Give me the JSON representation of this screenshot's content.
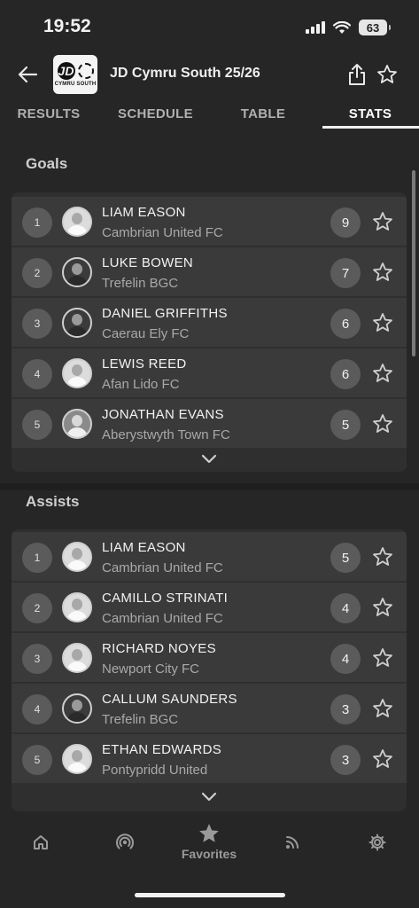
{
  "status_bar": {
    "time": "19:52",
    "battery": "63"
  },
  "header": {
    "title": "JD Cymru South 25/26",
    "logo_text": "CYMRU SOUTH",
    "logo_mark": "JD"
  },
  "tabs": [
    {
      "label": "RESULTS",
      "active": false
    },
    {
      "label": "SCHEDULE",
      "active": false
    },
    {
      "label": "TABLE",
      "active": false
    },
    {
      "label": "STATS",
      "active": true
    }
  ],
  "goals": {
    "title": "Goals",
    "rows": [
      {
        "rank": "1",
        "name": "LIAM EASON",
        "team": "Cambrian United FC",
        "value": "9"
      },
      {
        "rank": "2",
        "name": "LUKE BOWEN",
        "team": "Trefelin BGC",
        "value": "7"
      },
      {
        "rank": "3",
        "name": "DANIEL GRIFFITHS",
        "team": "Caerau Ely FC",
        "value": "6"
      },
      {
        "rank": "4",
        "name": "LEWIS REED",
        "team": "Afan Lido FC",
        "value": "6"
      },
      {
        "rank": "5",
        "name": "JONATHAN EVANS",
        "team": "Aberystwyth Town FC",
        "value": "5"
      }
    ]
  },
  "assists": {
    "title": "Assists",
    "rows": [
      {
        "rank": "1",
        "name": "LIAM EASON",
        "team": "Cambrian United FC",
        "value": "5"
      },
      {
        "rank": "2",
        "name": "CAMILLO STRINATI",
        "team": "Cambrian United FC",
        "value": "4"
      },
      {
        "rank": "3",
        "name": "RICHARD NOYES",
        "team": "Newport City FC",
        "value": "4"
      },
      {
        "rank": "4",
        "name": "CALLUM SAUNDERS",
        "team": "Trefelin BGC",
        "value": "3"
      },
      {
        "rank": "5",
        "name": "ETHAN EDWARDS",
        "team": "Pontypridd United",
        "value": "3"
      }
    ]
  },
  "bottom_nav": {
    "favorites_label": "Favorites"
  },
  "icons": {
    "back": "arrow-left-icon",
    "share": "share-icon",
    "favorite": "star-outline-icon",
    "expand": "chevron-down-icon",
    "home": "home-icon",
    "live": "broadcast-icon",
    "favorites": "star-filled-icon",
    "feed": "rss-icon",
    "settings": "gear-icon"
  }
}
